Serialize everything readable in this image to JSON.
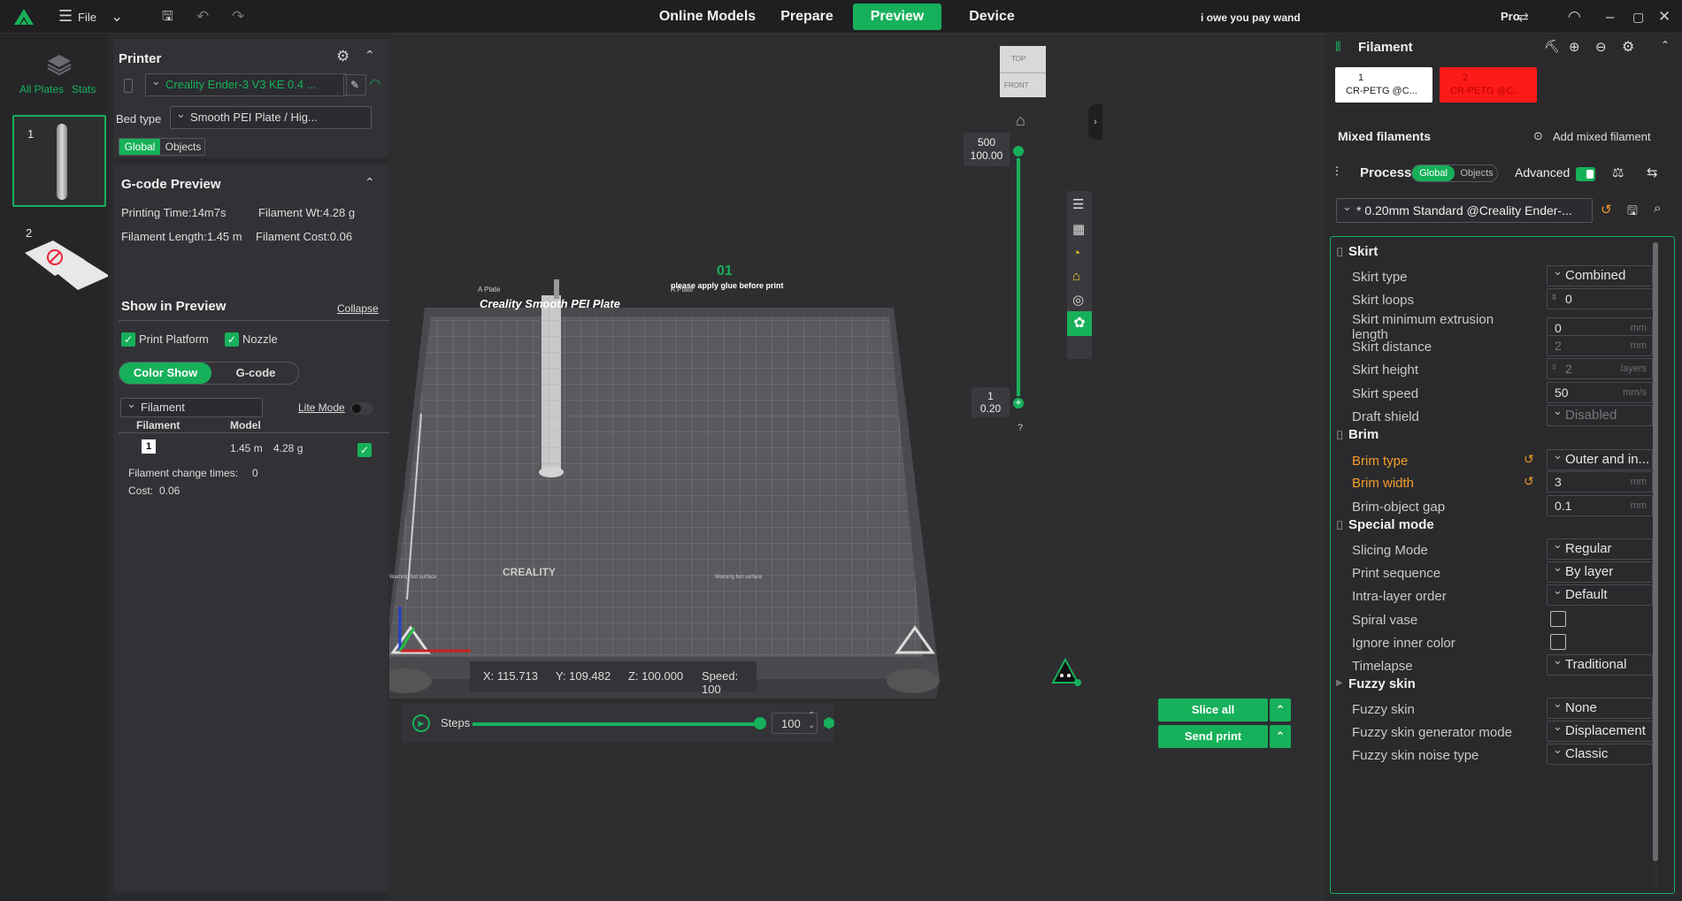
{
  "topbar": {
    "file_label": "File",
    "tabs": [
      "Online Models",
      "Prepare",
      "Preview",
      "Device"
    ],
    "user_text": "i owe you pay wand",
    "pro_label": "Pro"
  },
  "leftcol": {
    "all_plates": "All Plates",
    "stats": "Stats",
    "plates": [
      "1",
      "2"
    ]
  },
  "printer": {
    "title": "Printer",
    "printer_name": "Creality Ender-3 V3 KE 0.4 ...",
    "bed_type_label": "Bed type",
    "bed_type_value": "Smooth PEI Plate / Hig...",
    "scope_global": "Global",
    "scope_objects": "Objects"
  },
  "gcode_preview": {
    "title": "G-code Preview",
    "printing_time": "Printing Time:14m7s",
    "filament_wt": "Filament Wt:4.28 g",
    "filament_length": "Filament Length:1.45 m",
    "filament_cost": "Filament Cost:0.06"
  },
  "show_in_preview": {
    "title": "Show in Preview",
    "collapse": "Collapse",
    "print_platform": "Print Platform",
    "nozzle": "Nozzle",
    "color_show": "Color Show",
    "gcode": "G-code",
    "filament_dd": "Filament",
    "lite_mode": "Lite Mode",
    "col_filament": "Filament",
    "col_model": "Model",
    "row_index": "1",
    "row_length": "1.45 m",
    "row_weight": "4.28 g",
    "change_times_label": "Filament change times:",
    "change_times_value": "0",
    "cost_label": "Cost:",
    "cost_value": "0.06"
  },
  "viewport": {
    "cube_top": "TOP",
    "cube_front": "FRONT",
    "plate_number": "01",
    "plate_name": "Creality Smooth PEI Plate",
    "plate_notice": "please apply glue before print",
    "plate_tab_left": "A Plate",
    "plate_tab_right": "A Plate",
    "plate_brand": "CREALITY",
    "warning_left": "Warning hot surface",
    "warning_right": "Warning hot surface",
    "slider_top_layer": "500",
    "slider_top_height": "100.00",
    "slider_bottom_layer": "1",
    "slider_bottom_height": "0.20",
    "help": "?",
    "coord_x": "X: 115.713",
    "coord_y": "Y: 109.482",
    "coord_z": "Z: 100.000",
    "speed": "Speed: 100",
    "steps_label": "Steps",
    "steps_value": "100",
    "steps_percent": 100,
    "slice_all": "Slice all",
    "send_print": "Send print"
  },
  "filament_panel": {
    "title": "Filament",
    "slots": [
      {
        "index": "1",
        "name": "CR-PETG @C...",
        "color": "#ffffff"
      },
      {
        "index": "2",
        "name": "CR-PETG @C...",
        "color": "#ff1a1a"
      }
    ],
    "mixed_filaments": "Mixed filaments",
    "add_mixed": "Add mixed filament"
  },
  "process": {
    "title": "Process",
    "scope_global": "Global",
    "scope_objects": "Objects",
    "advanced": "Advanced",
    "preset": "* 0.20mm Standard @Creality Ender-..."
  },
  "settings": {
    "skirt_title": "Skirt",
    "skirt_type": {
      "label": "Skirt type",
      "value": "Combined"
    },
    "skirt_loops": {
      "label": "Skirt loops",
      "value": "0"
    },
    "skirt_min_extrusion": {
      "label": "Skirt minimum extrusion length",
      "value": "0",
      "unit": "mm"
    },
    "skirt_distance": {
      "label": "Skirt distance",
      "value": "2",
      "unit": "mm"
    },
    "skirt_height": {
      "label": "Skirt height",
      "value": "2",
      "unit": "layers"
    },
    "skirt_speed": {
      "label": "Skirt speed",
      "value": "50",
      "unit": "mm/s"
    },
    "draft_shield": {
      "label": "Draft shield",
      "value": "Disabled"
    },
    "brim_title": "Brim",
    "brim_type": {
      "label": "Brim type",
      "value": "Outer and in..."
    },
    "brim_width": {
      "label": "Brim width",
      "value": "3",
      "unit": "mm"
    },
    "brim_object_gap": {
      "label": "Brim-object gap",
      "value": "0.1",
      "unit": "mm"
    },
    "special_title": "Special mode",
    "slicing_mode": {
      "label": "Slicing Mode",
      "value": "Regular"
    },
    "print_sequence": {
      "label": "Print sequence",
      "value": "By layer"
    },
    "intra_layer_order": {
      "label": "Intra-layer order",
      "value": "Default"
    },
    "spiral_vase": {
      "label": "Spiral vase"
    },
    "ignore_inner_color": {
      "label": "Ignore inner color"
    },
    "timelapse": {
      "label": "Timelapse",
      "value": "Traditional"
    },
    "fuzzy_title": "Fuzzy skin",
    "fuzzy_skin": {
      "label": "Fuzzy skin",
      "value": "None"
    },
    "fuzzy_generator": {
      "label": "Fuzzy skin generator mode",
      "value": "Displacement"
    },
    "fuzzy_noise": {
      "label": "Fuzzy skin noise type",
      "value": "Classic"
    }
  },
  "colors": {
    "accent": "#17b05a",
    "warning_orange": "#f39c2b",
    "filament_red": "#ff1a1a"
  }
}
